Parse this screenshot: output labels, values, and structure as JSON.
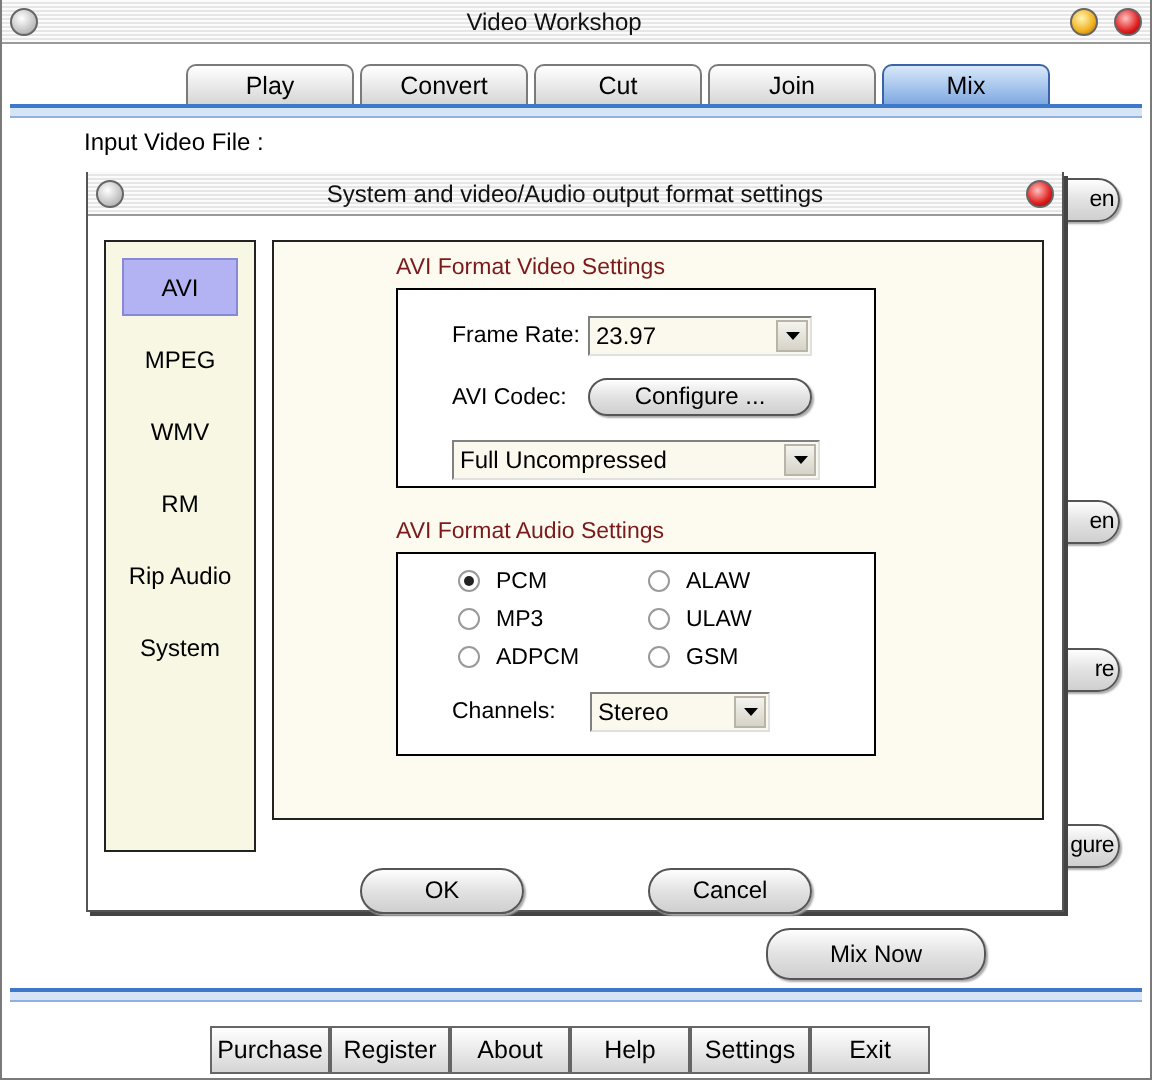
{
  "window": {
    "title": "Video Workshop"
  },
  "tabs": [
    {
      "label": "Play",
      "selected": false
    },
    {
      "label": "Convert",
      "selected": false
    },
    {
      "label": "Cut",
      "selected": false
    },
    {
      "label": "Join",
      "selected": false
    },
    {
      "label": "Mix",
      "selected": true
    }
  ],
  "input_label": "Input Video File :",
  "background_buttons": [
    "en",
    "en",
    "re",
    "gure"
  ],
  "mix_button": "Mix Now",
  "bottom_buttons": [
    "Purchase",
    "Register",
    "About",
    "Help",
    "Settings",
    "Exit"
  ],
  "dialog": {
    "title": "System and video/Audio output format settings",
    "categories": [
      {
        "label": "AVI",
        "selected": true
      },
      {
        "label": "MPEG",
        "selected": false
      },
      {
        "label": "WMV",
        "selected": false
      },
      {
        "label": "RM",
        "selected": false
      },
      {
        "label": "Rip Audio",
        "selected": false
      },
      {
        "label": "System",
        "selected": false
      }
    ],
    "video_settings": {
      "heading": "AVI Format Video Settings",
      "frame_rate_label": "Frame Rate:",
      "frame_rate_value": "23.97",
      "codec_label": "AVI Codec:",
      "configure_button": "Configure ...",
      "codec_value": "Full Uncompressed"
    },
    "audio_settings": {
      "heading": "AVI Format Audio Settings",
      "formats": [
        {
          "label": "PCM",
          "selected": true
        },
        {
          "label": "ALAW",
          "selected": false
        },
        {
          "label": "MP3",
          "selected": false
        },
        {
          "label": "ULAW",
          "selected": false
        },
        {
          "label": "ADPCM",
          "selected": false
        },
        {
          "label": "GSM",
          "selected": false
        }
      ],
      "channels_label": "Channels:",
      "channels_value": "Stereo"
    },
    "buttons": [
      "OK",
      "Cancel"
    ]
  }
}
